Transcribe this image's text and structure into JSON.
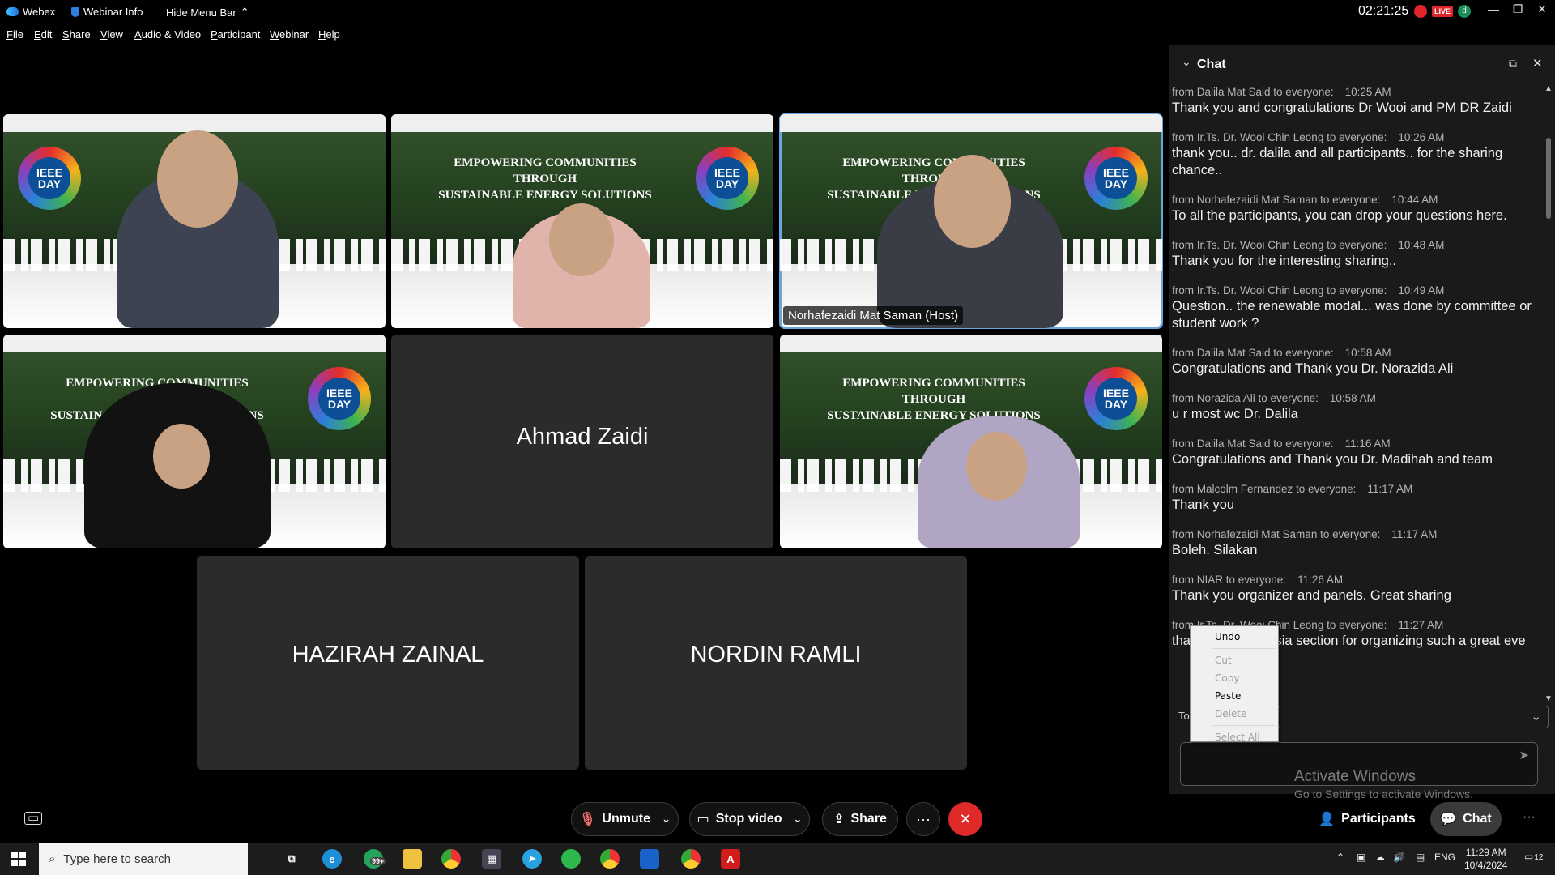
{
  "titlebar": {
    "app_name": "Webex",
    "webinar_info": "Webinar Info",
    "hide_menu": "Hide Menu Bar",
    "clock": "02:21:25",
    "live_badge": "LIVE",
    "avatar_letter": "d"
  },
  "menu": [
    "File",
    "Edit",
    "Share",
    "View",
    "Audio & Video",
    "Participant",
    "Webinar",
    "Help"
  ],
  "tiles": {
    "banner_line1": "EMPOWERING COMMUNITIES THROUGH",
    "banner_line2": "SUSTAINABLE ENERGY SOLUTIONS",
    "badge_text": "IEEE DAY",
    "host_name": "Norhafezaidi Mat Saman (Host)",
    "ahmad": "Ahmad Zaidi",
    "hazirah": "HAZIRAH ZAINAL",
    "nordin": "NORDIN RAMLI"
  },
  "chat": {
    "title": "Chat",
    "messages": [
      {
        "sender": "from Dalila Mat Said to everyone:",
        "time": "10:25 AM",
        "text": "Thank you and congratulations Dr Wooi and PM DR Zaidi"
      },
      {
        "sender": "from Ir.Ts. Dr. Wooi Chin Leong to everyone:",
        "time": "10:26 AM",
        "text": "thank you.. dr. dalila and all participants.. for the sharing chance.."
      },
      {
        "sender": "from Norhafezaidi Mat Saman to everyone:",
        "time": "10:44 AM",
        "text": "To all the participants, you can drop your questions here."
      },
      {
        "sender": "from Ir.Ts. Dr. Wooi Chin Leong to everyone:",
        "time": "10:48 AM",
        "text": "Thank you for the interesting sharing.."
      },
      {
        "sender": "from Ir.Ts. Dr. Wooi Chin Leong to everyone:",
        "time": "10:49 AM",
        "text": "Question.. the renewable modal... was done by committee or student work ?"
      },
      {
        "sender": "from Dalila Mat Said to everyone:",
        "time": "10:58 AM",
        "text": "Congratulations and Thank you Dr. Norazida Ali"
      },
      {
        "sender": "from Norazida Ali to everyone:",
        "time": "10:58 AM",
        "text": "u r most wc Dr. Dalila"
      },
      {
        "sender": "from Dalila Mat Said to everyone:",
        "time": "11:16 AM",
        "text": "Congratulations and Thank you Dr. Madihah and team"
      },
      {
        "sender": "from Malcolm Fernandez to everyone:",
        "time": "11:17 AM",
        "text": "Thank you"
      },
      {
        "sender": "from Norhafezaidi Mat Saman to everyone:",
        "time": "11:17 AM",
        "text": "Boleh. Silakan"
      },
      {
        "sender": "from NIAR to everyone:",
        "time": "11:26 AM",
        "text": "Thank you organizer and panels. Great sharing"
      },
      {
        "sender": "from Ir.Ts. Dr. Wooi Chin Leong to everyone:",
        "time": "11:27 AM",
        "text": "tha                   aysia section for organizing such a great eve"
      }
    ],
    "to_label": "To",
    "activate_line1": "Activate Windows",
    "activate_line2": "Go to Settings to activate Windows."
  },
  "context_menu": {
    "undo": "Undo",
    "cut": "Cut",
    "copy": "Copy",
    "paste": "Paste",
    "delete": "Delete",
    "select_all": "Select All"
  },
  "controls": {
    "unmute": "Unmute",
    "stop_video": "Stop video",
    "share": "Share",
    "more": "···",
    "participants": "Participants",
    "chat": "Chat"
  },
  "taskbar": {
    "search_placeholder": "Type here to search",
    "whatsapp_badge": "99+",
    "lang": "ENG",
    "time": "11:29 AM",
    "date": "10/4/2024",
    "notifications": "12"
  }
}
